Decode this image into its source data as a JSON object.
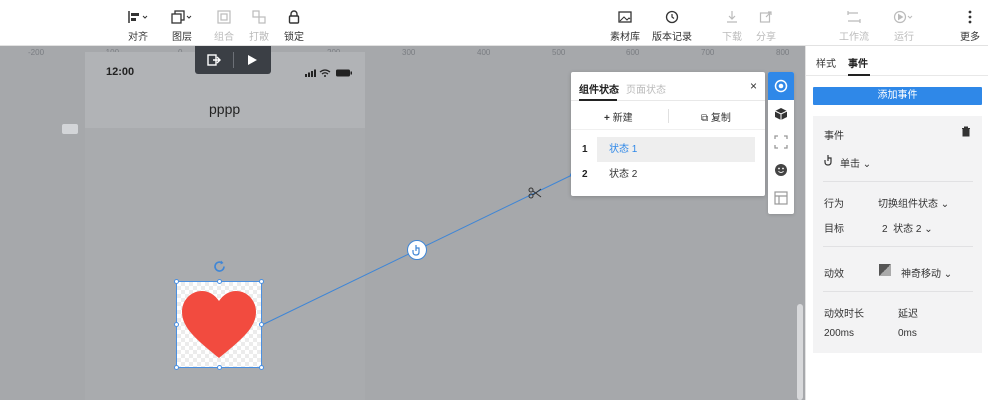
{
  "toolbar": {
    "align": "对齐",
    "layers": "图层",
    "group": "组合",
    "ungroup": "打散",
    "lock": "锁定",
    "assets": "素材库",
    "history": "版本记录",
    "download": "下载",
    "share": "分享",
    "workflow": "工作流",
    "run": "运行",
    "more": "更多"
  },
  "ruler": [
    "-200",
    "-100",
    "0",
    "100",
    "200",
    "300",
    "400",
    "500",
    "600",
    "700",
    "800"
  ],
  "device": {
    "time": "12:00",
    "title": "pppp"
  },
  "state_panel": {
    "tab_component_state": "组件状态",
    "tab_page_state": "页面状态",
    "close": "×",
    "new_label": "新建",
    "copy_label": "复制",
    "states": [
      {
        "num": "1",
        "name": "状态 1"
      },
      {
        "num": "2",
        "name": "状态 2"
      }
    ]
  },
  "right_panel": {
    "tab_style": "样式",
    "tab_events": "事件",
    "add_event": "添加事件",
    "event_label": "事件",
    "trigger": "单击",
    "behavior_label": "行为",
    "behavior_value": "切换组件状态",
    "target_label": "目标",
    "target_value": "2  状态 2",
    "animation_label": "动效",
    "animation_value": "神奇移动",
    "duration_label": "动效时长",
    "duration_value": "200ms",
    "delay_label": "延迟",
    "delay_value": "0ms"
  },
  "colors": {
    "accent": "#2f88e8",
    "heart": "#f24b3f",
    "canvas": "#a6a8ab"
  }
}
